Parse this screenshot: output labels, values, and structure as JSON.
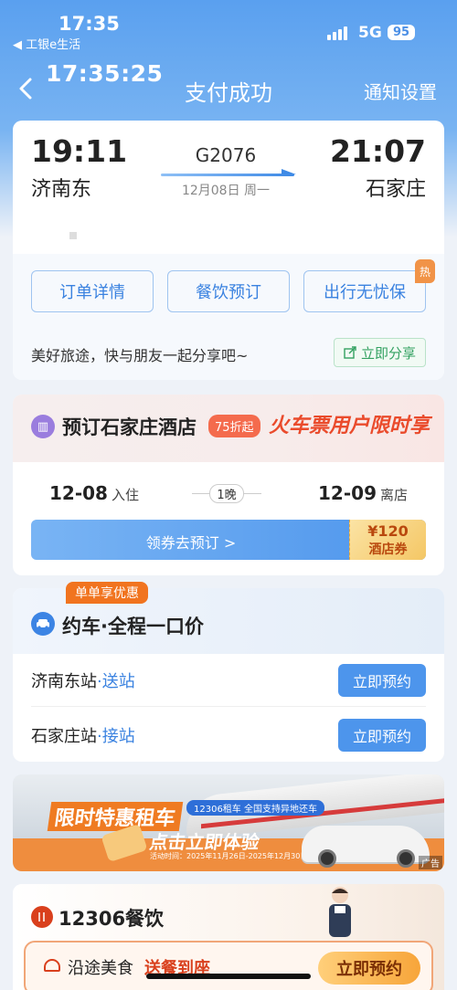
{
  "status_bar": {
    "time": "17:35",
    "back_app": "◀ 工银e生活",
    "network": "5G",
    "battery": "95"
  },
  "nav": {
    "clock": "17:35:25",
    "title": "支付成功",
    "right_action": "通知设置"
  },
  "ticket": {
    "depart_time": "19:11",
    "depart_station": "济南东",
    "train_no": "G2076",
    "date": "12月08日 周一",
    "arrive_time": "21:07",
    "arrive_station": "石家庄",
    "actions": [
      "订单详情",
      "餐饮预订",
      "出行无忧保"
    ],
    "hot_badge": "热",
    "share_text": "美好旅途，快与朋友一起分享吧~",
    "share_button": "立即分享"
  },
  "hotel": {
    "title": "预订石家庄酒店",
    "discount": "75折起",
    "promo": "火车票用户限时享",
    "checkin_date": "12-08",
    "checkin_label": "入住",
    "nights": "1晚",
    "checkout_date": "12-09",
    "checkout_label": "离店",
    "cta": "领券去预订 >",
    "coupon_amount": "¥120",
    "coupon_label": "酒店券"
  },
  "car": {
    "tag": "单单享优惠",
    "title": "约车·全程一口价",
    "rows": [
      {
        "station": "济南东站",
        "sep": "·",
        "action_text": "送站",
        "button": "立即预约"
      },
      {
        "station": "石家庄站",
        "sep": "·",
        "action_text": "接站",
        "button": "立即预约"
      }
    ]
  },
  "ad": {
    "headline": "限时特惠租车",
    "subhead": "点击立即体验",
    "tagline": "12306租车 全国支持异地还车",
    "period": "活动时间：2025年11月26日-2025年12月30日",
    "label": "广告"
  },
  "dining": {
    "title": "12306餐饮",
    "panel_text": "沿途美食",
    "panel_emphasis": "送餐到座",
    "button": "立即预约"
  },
  "colors": {
    "primary_blue": "#4d95ec",
    "orange": "#f1741f",
    "promo_red": "#ea4b2c"
  }
}
